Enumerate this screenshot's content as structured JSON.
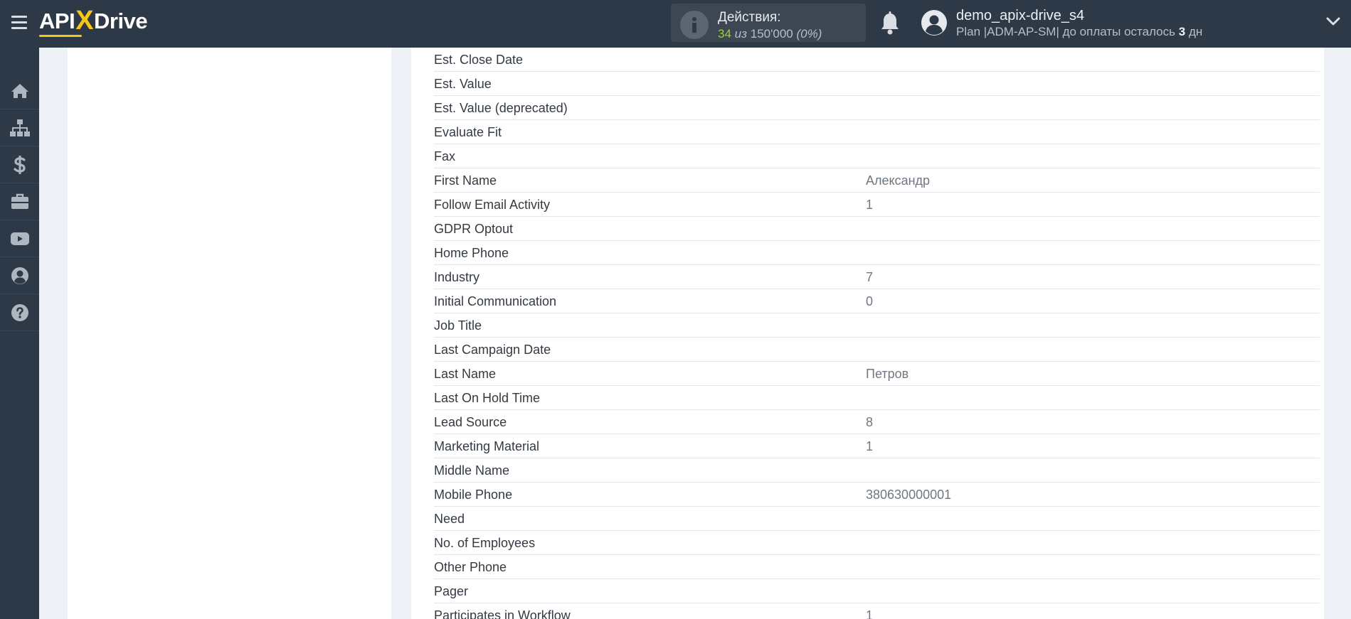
{
  "header": {
    "logo_left": "API",
    "logo_x": "X",
    "logo_right": "Drive",
    "actions_title": "Действия:",
    "actions_used": "34",
    "actions_separator": "из",
    "actions_total": "150'000",
    "actions_percent": "(0%)",
    "user_name": "demo_apix-drive_s4",
    "plan_text": "Plan |ADM-AP-SM| до оплаты осталось",
    "plan_days": "3",
    "plan_days_unit": "дн"
  },
  "colors": {
    "topbar": "#2d3946",
    "accent_yellow": "#f5c518",
    "actions_green": "#9bcf3a"
  },
  "sidebar": {
    "items": [
      {
        "icon": "home-icon"
      },
      {
        "icon": "sitemap-icon"
      },
      {
        "icon": "dollar-icon"
      },
      {
        "icon": "briefcase-icon"
      },
      {
        "icon": "youtube-icon"
      },
      {
        "icon": "user-icon"
      },
      {
        "icon": "help-icon"
      }
    ]
  },
  "fields": [
    {
      "label": "Est. Close Date",
      "value": ""
    },
    {
      "label": "Est. Value",
      "value": ""
    },
    {
      "label": "Est. Value (deprecated)",
      "value": ""
    },
    {
      "label": "Evaluate Fit",
      "value": ""
    },
    {
      "label": "Fax",
      "value": ""
    },
    {
      "label": "First Name",
      "value": "Александр"
    },
    {
      "label": "Follow Email Activity",
      "value": "1"
    },
    {
      "label": "GDPR Optout",
      "value": ""
    },
    {
      "label": "Home Phone",
      "value": ""
    },
    {
      "label": "Industry",
      "value": "7"
    },
    {
      "label": "Initial Communication",
      "value": "0"
    },
    {
      "label": "Job Title",
      "value": ""
    },
    {
      "label": "Last Campaign Date",
      "value": ""
    },
    {
      "label": "Last Name",
      "value": "Петров"
    },
    {
      "label": "Last On Hold Time",
      "value": ""
    },
    {
      "label": "Lead Source",
      "value": "8"
    },
    {
      "label": "Marketing Material",
      "value": "1"
    },
    {
      "label": "Middle Name",
      "value": ""
    },
    {
      "label": "Mobile Phone",
      "value": "380630000001"
    },
    {
      "label": "Need",
      "value": ""
    },
    {
      "label": "No. of Employees",
      "value": ""
    },
    {
      "label": "Other Phone",
      "value": ""
    },
    {
      "label": "Pager",
      "value": ""
    },
    {
      "label": "Participates in Workflow",
      "value": "1"
    }
  ]
}
